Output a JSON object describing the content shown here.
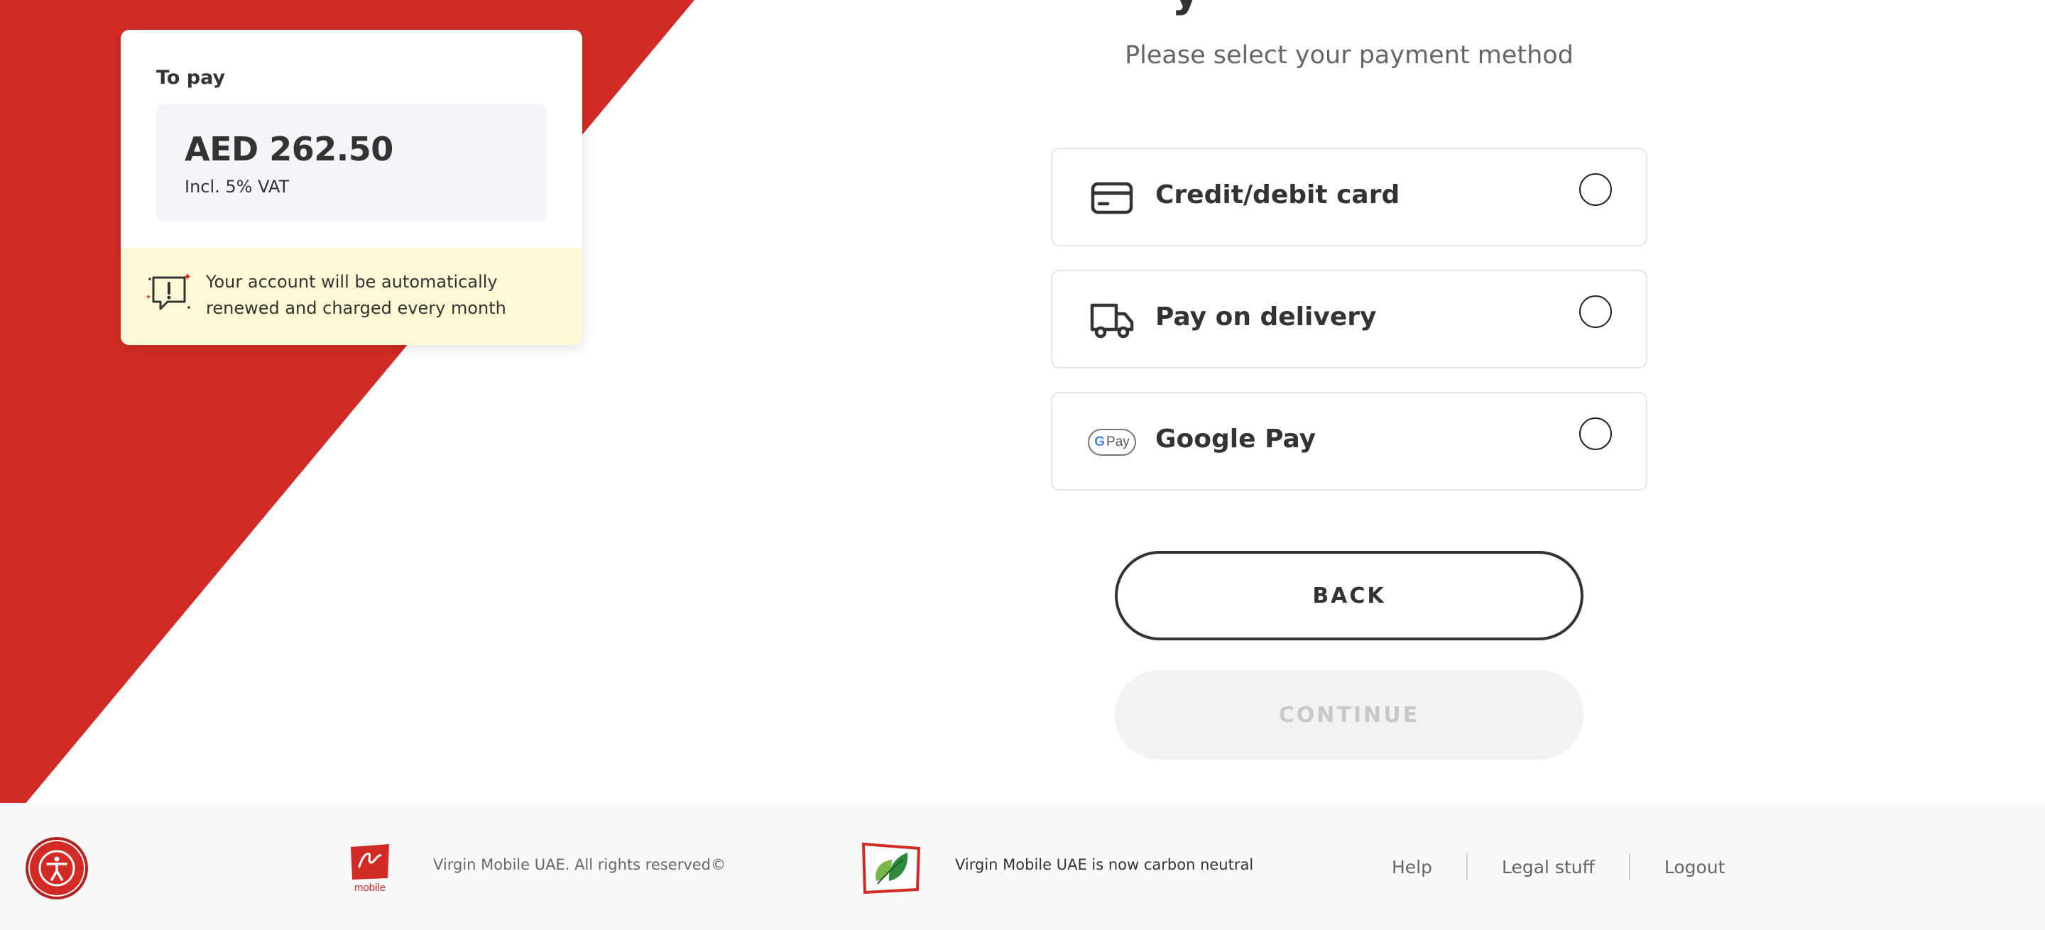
{
  "summary": {
    "label": "To pay",
    "amount": "AED 262.50",
    "vat_note": "Incl. 5% VAT",
    "notice": "Your account will be automatically renewed and charged every month"
  },
  "main": {
    "subtitle": "Please select your payment method",
    "payment_options": [
      {
        "label": "Credit/debit card",
        "icon": "credit-card-icon"
      },
      {
        "label": "Pay on delivery",
        "icon": "delivery-truck-icon"
      },
      {
        "label": "Google Pay",
        "icon": "google-pay-icon",
        "icon_text": "Pay",
        "icon_letter": "G"
      }
    ],
    "back_label": "BACK",
    "continue_label": "CONTINUE"
  },
  "footer": {
    "logo_text": "mobile",
    "copyright": "Virgin Mobile UAE. All rights reserved©",
    "carbon_text": "Virgin Mobile UAE is now carbon neutral",
    "links": [
      "Help",
      "Legal stuff",
      "Logout"
    ]
  },
  "colors": {
    "brand_red": "#d22b25",
    "notice_bg": "#fdf8d6",
    "amount_bg": "#f5f4f9"
  }
}
